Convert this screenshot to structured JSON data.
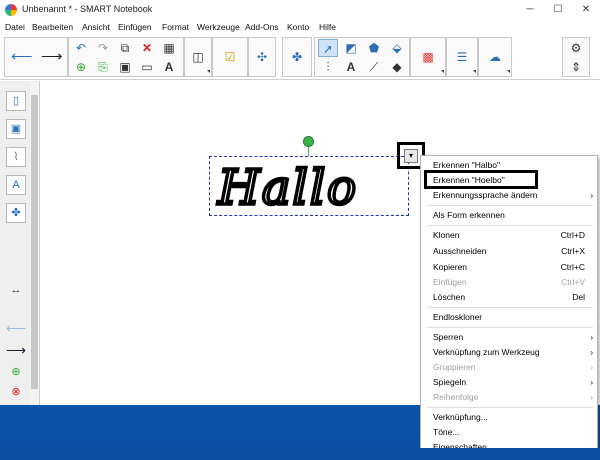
{
  "window": {
    "title": "Unbenannt * - SMART Notebook",
    "controls": {
      "minimize": "─",
      "maximize": "☐",
      "close": "✕"
    }
  },
  "menubar": [
    "Datei",
    "Bearbeiten",
    "Ansicht",
    "Einfügen",
    "Format",
    "Werkzeuge",
    "Add-Ons",
    "Konto",
    "Hilfe"
  ],
  "toolbar": {
    "icons": [
      "back-arrow",
      "forward-arrow",
      "undo",
      "redo",
      "screen-capture",
      "delete",
      "table",
      "page-add",
      "save",
      "display",
      "text-style",
      "document-camera",
      "screen-shade",
      "add-ons",
      "select",
      "shapes",
      "eraser-fill",
      "pens",
      "text",
      "line",
      "eraser",
      "properties",
      "settings",
      "move-toolbar"
    ]
  },
  "sidebar": {
    "icons": [
      "page-sorter",
      "gallery",
      "attachments",
      "properties",
      "add-ons",
      "expand-arrows",
      "previous-page",
      "next-page",
      "add-page",
      "delete-page"
    ]
  },
  "canvas": {
    "handwriting": "Hallo"
  },
  "context_menu": {
    "items": [
      {
        "label": "Erkennen \"Halbo\"",
        "shortcut": "",
        "disabled": false,
        "submenu": false
      },
      {
        "label": "Erkennen \"Hoelbo\"",
        "shortcut": "",
        "disabled": false,
        "submenu": false
      },
      {
        "label": "Erkennungssprache ändern",
        "shortcut": "",
        "disabled": false,
        "submenu": true
      },
      {
        "label": "Als Form erkennen",
        "shortcut": "",
        "disabled": false,
        "submenu": false
      },
      {
        "label": "Klonen",
        "shortcut": "Ctrl+D",
        "disabled": false,
        "submenu": false
      },
      {
        "label": "Ausschneiden",
        "shortcut": "Ctrl+X",
        "disabled": false,
        "submenu": false
      },
      {
        "label": "Kopieren",
        "shortcut": "Ctrl+C",
        "disabled": false,
        "submenu": false
      },
      {
        "label": "Einfügen",
        "shortcut": "Ctrl+V",
        "disabled": true,
        "submenu": false
      },
      {
        "label": "Löschen",
        "shortcut": "Del",
        "disabled": false,
        "submenu": false
      },
      {
        "label": "Endloskloner",
        "shortcut": "",
        "disabled": false,
        "submenu": false
      },
      {
        "label": "Sperren",
        "shortcut": "",
        "disabled": false,
        "submenu": true
      },
      {
        "label": "Verknüpfung zum Werkzeug",
        "shortcut": "",
        "disabled": false,
        "submenu": true
      },
      {
        "label": "Gruppieren",
        "shortcut": "",
        "disabled": true,
        "submenu": true
      },
      {
        "label": "Spiegeln",
        "shortcut": "",
        "disabled": false,
        "submenu": true
      },
      {
        "label": "Reihenfolge",
        "shortcut": "",
        "disabled": true,
        "submenu": true
      },
      {
        "label": "Verknüpfung...",
        "shortcut": "",
        "disabled": false,
        "submenu": false
      },
      {
        "label": "Töne...",
        "shortcut": "",
        "disabled": false,
        "submenu": false
      },
      {
        "label": "Eigenschaften...",
        "shortcut": "",
        "disabled": false,
        "submenu": false
      }
    ]
  },
  "colors": {
    "accent": "#2c6fb5",
    "delete": "#dd2222",
    "rotate_handle": "#3cb34a",
    "selection_border": "#2233bb",
    "desktop": "#0b5db8"
  }
}
